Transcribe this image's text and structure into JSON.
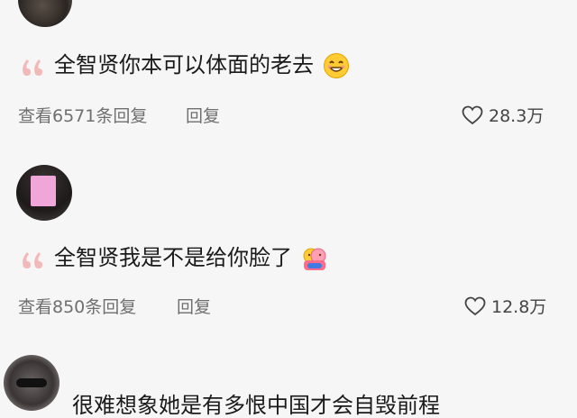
{
  "comments": [
    {
      "text": "全智贤你本可以体面的老去",
      "emoji": "smiling-face-emoji",
      "view_replies": "查看6571条回复",
      "reply": "回复",
      "likes": "28.3万"
    },
    {
      "text": "全智贤我是不是给你脸了",
      "emoji": "hugging-face-emoji",
      "view_replies": "查看850条回复",
      "reply": "回复",
      "likes": "12.8万"
    },
    {
      "text": "很难想象她是有多恨中国才会自毁前程"
    }
  ],
  "colors": {
    "background": "#f6f6f6",
    "quote_mark": "#f3b8b8",
    "meta_text": "#6f6f6f"
  }
}
